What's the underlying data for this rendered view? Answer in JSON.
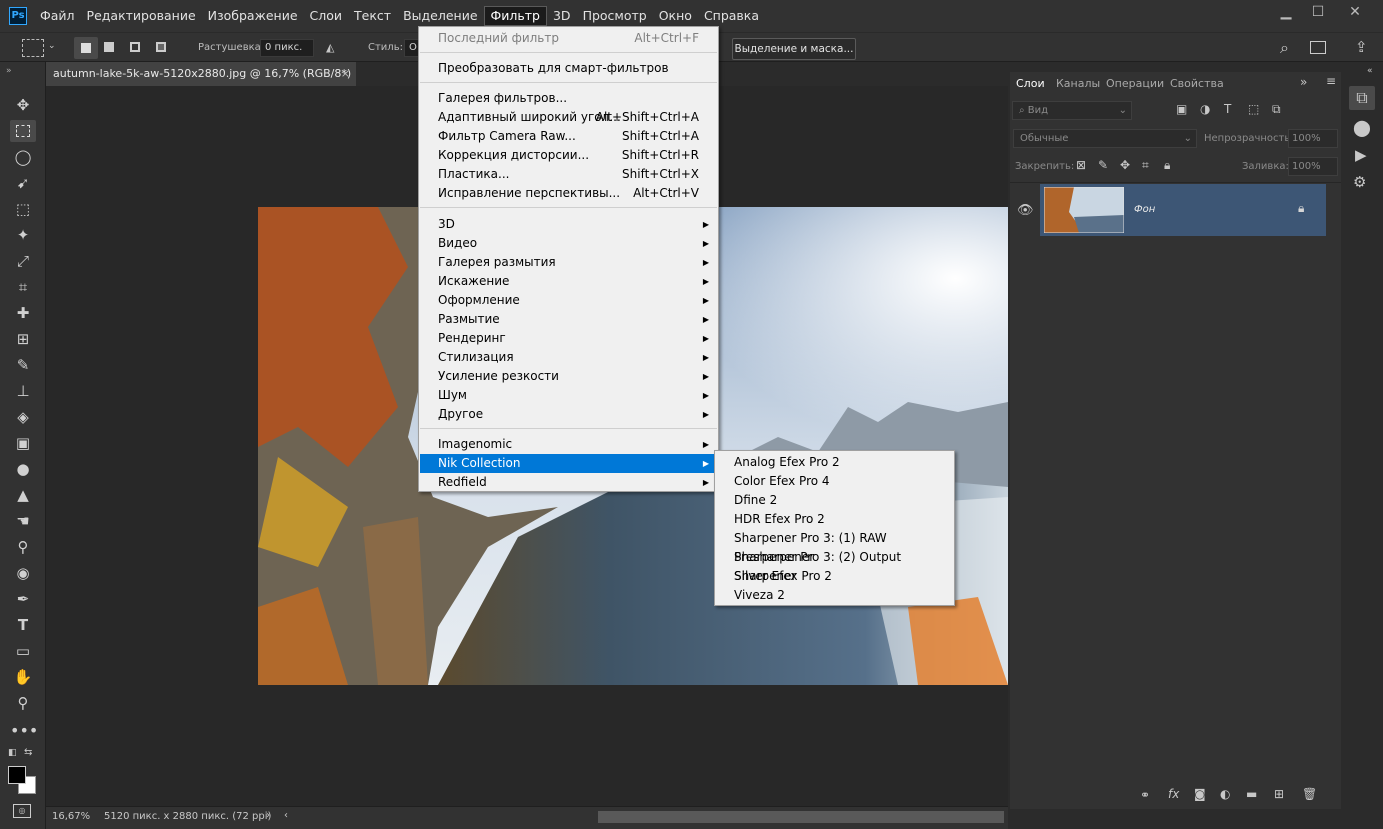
{
  "app": {
    "logo": "Ps"
  },
  "menubar": {
    "items": [
      "Файл",
      "Редактирование",
      "Изображение",
      "Слои",
      "Текст",
      "Выделение",
      "Фильтр",
      "3D",
      "Просмотр",
      "Окно",
      "Справка"
    ],
    "active": "Фильтр"
  },
  "window_controls": {
    "minimize": "▁",
    "maximize": "☐",
    "close": "✕"
  },
  "options": {
    "feather_label": "Растушевка:",
    "feather_value": "0 пикс.",
    "style_label": "Стиль:",
    "style_value": "О",
    "select_mask_button": "Выделение и маска..."
  },
  "document": {
    "tab_title": "autumn-lake-5k-aw-5120x2880.jpg @ 16,7% (RGB/8*)",
    "close": "×",
    "zoom": "16,67%",
    "info": "5120 пикс. x 2880 пикс. (72 ppi)"
  },
  "filter_menu": {
    "last_filter": {
      "label": "Последний фильтр",
      "shortcut": "Alt+Ctrl+F"
    },
    "smart": "Преобразовать для смарт-фильтров",
    "group1": [
      {
        "label": "Галерея фильтров...",
        "shortcut": ""
      },
      {
        "label": "Адаптивный широкий угол...",
        "shortcut": "Alt+Shift+Ctrl+A"
      },
      {
        "label": "Фильтр Camera Raw...",
        "shortcut": "Shift+Ctrl+A"
      },
      {
        "label": "Коррекция дисторсии...",
        "shortcut": "Shift+Ctrl+R"
      },
      {
        "label": "Пластика...",
        "shortcut": "Shift+Ctrl+X"
      },
      {
        "label": "Исправление перспективы...",
        "shortcut": "Alt+Ctrl+V"
      }
    ],
    "submenus": [
      "3D",
      "Видео",
      "Галерея размытия",
      "Искажение",
      "Оформление",
      "Размытие",
      "Рендеринг",
      "Стилизация",
      "Усиление резкости",
      "Шум",
      "Другое"
    ],
    "plugins": [
      "Imagenomic",
      "Nik Collection",
      "Redfield"
    ],
    "highlighted": "Nik Collection"
  },
  "nik_submenu": [
    "Analog Efex Pro 2",
    "Color Efex Pro 4",
    "Dfine 2",
    "HDR Efex Pro 2",
    "Sharpener Pro 3: (1) RAW Presharpener",
    "Sharpener Pro 3: (2) Output Sharpener",
    "Silver Efex Pro 2",
    "Viveza 2"
  ],
  "layers_panel": {
    "tabs": [
      "Слои",
      "Каналы",
      "Операции",
      "Свойства"
    ],
    "active_tab": "Слои",
    "filter_placeholder": "Вид",
    "blend_mode": "Обычные",
    "opacity_label": "Непрозрачность:",
    "opacity_value": "100%",
    "lock_label": "Закрепить:",
    "fill_label": "Заливка:",
    "fill_value": "100%",
    "layer_name": "Фон"
  },
  "colors": {
    "accent": "#0078d7",
    "selected_layer": "#3d5675",
    "chrome": "#323232"
  }
}
